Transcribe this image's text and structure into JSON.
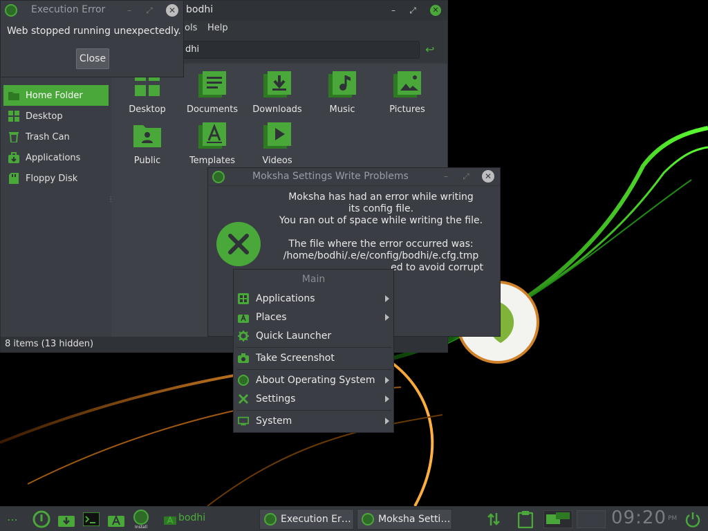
{
  "colors": {
    "accent": "#4aa83a",
    "panel": "#3a3d43",
    "titlebar": "#2f3237"
  },
  "file_manager": {
    "title": "bodhi",
    "menu": [
      "ols",
      "Help"
    ],
    "location": "dhi",
    "sidebar": [
      {
        "label": "Home Folder",
        "icon": "home-folder-icon",
        "active": true
      },
      {
        "label": "Desktop",
        "icon": "desktop-icon",
        "active": false
      },
      {
        "label": "Trash Can",
        "icon": "trash-icon",
        "active": false
      },
      {
        "label": "Applications",
        "icon": "applications-icon",
        "active": false
      },
      {
        "label": "Floppy Disk",
        "icon": "floppy-disk-icon",
        "active": false
      }
    ],
    "files": [
      {
        "label": "Desktop",
        "icon": "desktop-folder-icon"
      },
      {
        "label": "Documents",
        "icon": "documents-folder-icon"
      },
      {
        "label": "Downloads",
        "icon": "downloads-folder-icon"
      },
      {
        "label": "Music",
        "icon": "music-folder-icon"
      },
      {
        "label": "Pictures",
        "icon": "pictures-folder-icon"
      },
      {
        "label": "Public",
        "icon": "public-folder-icon"
      },
      {
        "label": "Templates",
        "icon": "templates-folder-icon"
      },
      {
        "label": "Videos",
        "icon": "videos-folder-icon"
      }
    ],
    "status": "8 items (13 hidden)"
  },
  "execution_error": {
    "title": "Execution Error",
    "message": "Web stopped running unexpectedly.",
    "close_label": "Close"
  },
  "moksha_dialog": {
    "title": "Moksha Settings Write Problems",
    "lines": [
      "Moksha has had an error while writing",
      "its config file.",
      "You ran out of space while writing the file.",
      "",
      "The file where the error occurred was:",
      "/home/bodhi/.e/e/config/bodhi/e.cfg.tmp",
      "ed to avoid corrupt"
    ]
  },
  "main_menu": {
    "title": "Main",
    "items": [
      {
        "label": "Applications",
        "icon": "applications-grid-icon",
        "submenu": true
      },
      {
        "label": "Places",
        "icon": "places-icon",
        "submenu": true
      },
      {
        "label": "Quick Launcher",
        "icon": "gear-icon",
        "submenu": false
      },
      {
        "label": "Take Screenshot",
        "icon": "camera-icon",
        "submenu": false
      },
      {
        "label": "About Operating System",
        "icon": "bodhi-logo-icon",
        "submenu": true
      },
      {
        "label": "Settings",
        "icon": "tools-icon",
        "submenu": true
      },
      {
        "label": "System",
        "icon": "monitor-icon",
        "submenu": true
      }
    ]
  },
  "taskbar": {
    "bodhi_label": "bodhi",
    "install_label": "Install",
    "tasks": [
      {
        "label": "Execution Er…"
      },
      {
        "label": "Moksha Setti…"
      }
    ],
    "clock": {
      "hour": "09",
      "minute": "20",
      "ampm": "PM"
    }
  }
}
